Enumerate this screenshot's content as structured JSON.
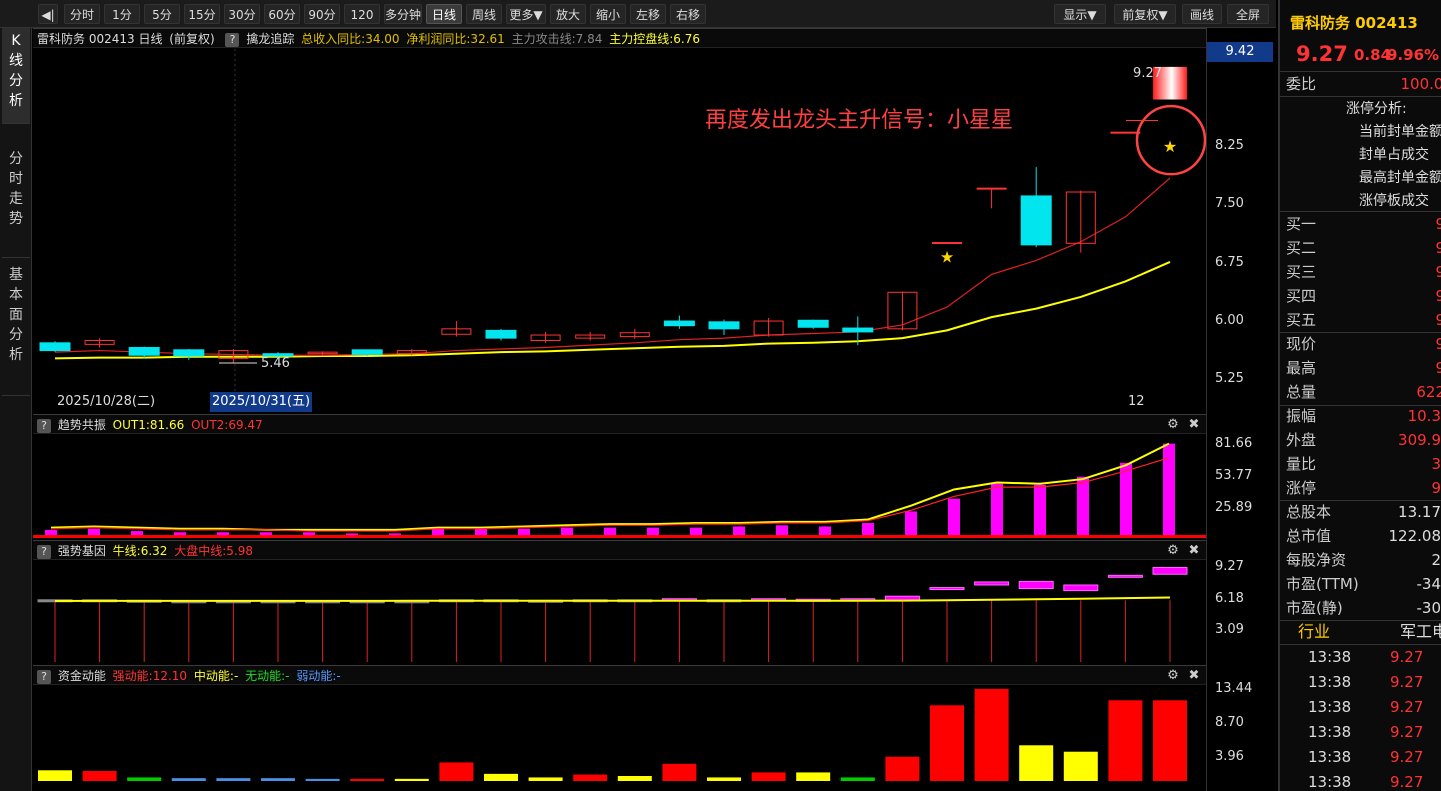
{
  "toolbar": {
    "back_icon": "back-arrow-icon",
    "buttons": [
      "分时",
      "1分",
      "5分",
      "15分",
      "30分",
      "60分",
      "90分",
      "120分",
      "多分钟",
      "日线",
      "周线",
      "更多▼",
      "放大",
      "缩小",
      "左移",
      "右移"
    ],
    "active": "日线",
    "right_buttons": [
      "显示▼",
      "前复权▼",
      "画线",
      "全屏"
    ]
  },
  "sidebar": {
    "tabs": [
      "K线分析",
      "分时走势",
      "基本面分析"
    ]
  },
  "main_header": {
    "stock": "雷科防务 002413 日线",
    "adjust": "(前复权)",
    "indicator": "擒龙追踪",
    "revenue": "总收入同比:34.00",
    "profit": "净利润同比:32.61",
    "attack": "主力攻击线:7.84",
    "control": "主力控盘线:6.76"
  },
  "price_axis": {
    "current": "9.42",
    "ticks": [
      "8.25",
      "7.50",
      "6.75",
      "6.00",
      "5.25"
    ]
  },
  "annotation": {
    "text": "再度发出龙头主升信号：小星星",
    "high_label": "9.27",
    "low_label": "5.46"
  },
  "dates": {
    "d1": "2025/10/28(二)",
    "d2": "2025/10/31(五)",
    "d3": "12"
  },
  "ind1": {
    "name": "趋势共振",
    "out1": "OUT1:81.66",
    "out2": "OUT2:69.47",
    "ticks": [
      "81.66",
      "53.77",
      "25.89"
    ]
  },
  "ind2": {
    "name": "强势基因",
    "bull": "牛线:6.32",
    "market": "大盘中线:5.98",
    "ticks": [
      "9.27",
      "6.18",
      "3.09"
    ]
  },
  "ind3": {
    "name": "资金动能",
    "strong": "强动能:12.10",
    "mid": "中动能:-",
    "none": "无动能:-",
    "weak": "弱动能:-",
    "ticks": [
      "13.44",
      "8.70",
      "3.96"
    ]
  },
  "quote": {
    "name_code": "雷科防务 002413",
    "price": "9.27",
    "change": "0.84",
    "pct": "9.96%",
    "weibi_label": "委比",
    "weibi_value": "100.00",
    "limit_lines": [
      "涨停分析:",
      "当前封单金额",
      "封单占成交",
      "最高封单金额",
      "涨停板成交"
    ],
    "bids": [
      {
        "l": "买一",
        "v": "9"
      },
      {
        "l": "买二",
        "v": "9"
      },
      {
        "l": "买三",
        "v": "9"
      },
      {
        "l": "买四",
        "v": "9"
      },
      {
        "l": "买五",
        "v": "9"
      }
    ],
    "stats1": [
      {
        "l": "现价",
        "v": "9"
      },
      {
        "l": "最高",
        "v": "9"
      },
      {
        "l": "总量",
        "v": "622"
      }
    ],
    "stats2": [
      {
        "l": "振幅",
        "v": "10.3"
      },
      {
        "l": "外盘",
        "v": "309.9"
      },
      {
        "l": "量比",
        "v": "3"
      },
      {
        "l": "涨停",
        "v": "9"
      }
    ],
    "stats3": [
      {
        "l": "总股本",
        "v": "13.17"
      },
      {
        "l": "总市值",
        "v": "122.08"
      },
      {
        "l": "每股净资",
        "v": "2"
      },
      {
        "l": "市盈(TTM)",
        "v": "-34"
      },
      {
        "l": "市盈(静)",
        "v": "-30"
      }
    ],
    "industry_label": "行业",
    "industry_value": "军工电",
    "ticks": [
      {
        "t": "13:38",
        "p": "9.27"
      },
      {
        "t": "13:38",
        "p": "9.27"
      },
      {
        "t": "13:38",
        "p": "9.27"
      },
      {
        "t": "13:38",
        "p": "9.27"
      },
      {
        "t": "13:38",
        "p": "9.27"
      },
      {
        "t": "13:38",
        "p": "9.27"
      }
    ]
  },
  "chart_data": [
    {
      "type": "candlestick",
      "ylim": [
        5.1,
        9.5
      ],
      "ticks": [
        8.25,
        7.5,
        6.75,
        6.0,
        5.25
      ],
      "candles": [
        {
          "o": 5.72,
          "c": 5.62,
          "h": 5.74,
          "l": 5.6
        },
        {
          "o": 5.7,
          "c": 5.75,
          "h": 5.78,
          "l": 5.66
        },
        {
          "o": 5.66,
          "c": 5.56,
          "h": 5.67,
          "l": 5.52
        },
        {
          "o": 5.63,
          "c": 5.55,
          "h": 5.64,
          "l": 5.5
        },
        {
          "o": 5.52,
          "c": 5.62,
          "h": 5.64,
          "l": 5.46
        },
        {
          "o": 5.58,
          "c": 5.55,
          "h": 5.6,
          "l": 5.52
        },
        {
          "o": 5.58,
          "c": 5.6,
          "h": 5.61,
          "l": 5.55
        },
        {
          "o": 5.63,
          "c": 5.57,
          "h": 5.63,
          "l": 5.55
        },
        {
          "o": 5.58,
          "c": 5.62,
          "h": 5.64,
          "l": 5.56
        },
        {
          "o": 5.83,
          "c": 5.9,
          "h": 6.0,
          "l": 5.8
        },
        {
          "o": 5.88,
          "c": 5.78,
          "h": 5.9,
          "l": 5.75
        },
        {
          "o": 5.75,
          "c": 5.82,
          "h": 5.86,
          "l": 5.72
        },
        {
          "o": 5.78,
          "c": 5.82,
          "h": 5.86,
          "l": 5.75
        },
        {
          "o": 5.8,
          "c": 5.85,
          "h": 5.9,
          "l": 5.77
        },
        {
          "o": 6.0,
          "c": 5.94,
          "h": 6.07,
          "l": 5.9
        },
        {
          "o": 5.99,
          "c": 5.9,
          "h": 6.02,
          "l": 5.82
        },
        {
          "o": 5.82,
          "c": 6.0,
          "h": 6.04,
          "l": 5.8
        },
        {
          "o": 6.01,
          "c": 5.92,
          "h": 6.02,
          "l": 5.9
        },
        {
          "o": 5.91,
          "c": 5.86,
          "h": 6.06,
          "l": 5.69
        },
        {
          "o": 5.9,
          "c": 6.37,
          "h": 6.38,
          "l": 5.88
        },
        {
          "o": 7.01,
          "c": 7.01,
          "h": 7.01,
          "l": 7.01
        },
        {
          "o": 7.71,
          "c": 7.71,
          "h": 7.71,
          "l": 7.45
        },
        {
          "o": 7.61,
          "c": 6.98,
          "h": 7.98,
          "l": 6.95
        },
        {
          "o": 7.0,
          "c": 7.66,
          "h": 7.68,
          "l": 6.88
        },
        {
          "o": 8.43,
          "c": 8.43,
          "h": 8.43,
          "l": 8.43
        },
        {
          "o": 8.85,
          "c": 9.27,
          "h": 9.27,
          "l": 8.85
        }
      ],
      "ma_red": [
        5.6,
        5.62,
        5.6,
        5.58,
        5.57,
        5.56,
        5.56,
        5.57,
        5.58,
        5.62,
        5.64,
        5.66,
        5.69,
        5.72,
        5.76,
        5.78,
        5.82,
        5.84,
        5.86,
        5.95,
        6.18,
        6.6,
        6.78,
        7.02,
        7.34,
        7.84
      ],
      "ma_yellow": [
        5.52,
        5.53,
        5.53,
        5.54,
        5.54,
        5.54,
        5.55,
        5.55,
        5.56,
        5.58,
        5.6,
        5.61,
        5.63,
        5.65,
        5.67,
        5.68,
        5.71,
        5.72,
        5.74,
        5.78,
        5.88,
        6.05,
        6.16,
        6.31,
        6.51,
        6.76
      ],
      "stars": [
        {
          "index": 20,
          "value": 6.83
        },
        {
          "index": 25,
          "value": 8.25
        }
      ]
    },
    {
      "type": "bar",
      "name": "趋势共振",
      "ylim": [
        0,
        90
      ],
      "bars": [
        7,
        8,
        6,
        5,
        5,
        5,
        5,
        4,
        4,
        8,
        8,
        8,
        9,
        9,
        9,
        9,
        10,
        11,
        10,
        13,
        23,
        34,
        47,
        46,
        53,
        65,
        81.66
      ],
      "out1": [
        9,
        10,
        9,
        8,
        8,
        7,
        7,
        7,
        7,
        9,
        9,
        10,
        11,
        12,
        12,
        13,
        13,
        14,
        14,
        16,
        28,
        42,
        48,
        47,
        51,
        63,
        81.66
      ],
      "out2": [
        8,
        9,
        8,
        7,
        7,
        7,
        6,
        6,
        6,
        8,
        8,
        9,
        10,
        11,
        11,
        12,
        12,
        13,
        13,
        15,
        24,
        36,
        44,
        44,
        48,
        58,
        69.47
      ]
    },
    {
      "type": "bar",
      "name": "强势基因",
      "ylim": [
        0,
        10
      ],
      "bull": 6.32,
      "market": 5.98
    },
    {
      "type": "bar",
      "name": "资金动能",
      "ylim": [
        0,
        14
      ],
      "bars": [
        {
          "v": 1.5,
          "c": "yellow"
        },
        {
          "v": 1.4,
          "c": "red"
        },
        {
          "v": 0.5,
          "c": "green"
        },
        {
          "v": 0.4,
          "c": "blue"
        },
        {
          "v": 0.4,
          "c": "blue"
        },
        {
          "v": 0.4,
          "c": "blue"
        },
        {
          "v": 0.3,
          "c": "blue"
        },
        {
          "v": 0.3,
          "c": "red"
        },
        {
          "v": 0.3,
          "c": "yellow"
        },
        {
          "v": 2.6,
          "c": "red"
        },
        {
          "v": 1.0,
          "c": "yellow"
        },
        {
          "v": 0.5,
          "c": "yellow"
        },
        {
          "v": 0.9,
          "c": "red"
        },
        {
          "v": 0.7,
          "c": "yellow"
        },
        {
          "v": 2.4,
          "c": "red"
        },
        {
          "v": 0.5,
          "c": "yellow"
        },
        {
          "v": 1.2,
          "c": "red"
        },
        {
          "v": 1.2,
          "c": "yellow"
        },
        {
          "v": 0.5,
          "c": "green"
        },
        {
          "v": 3.4,
          "c": "red"
        },
        {
          "v": 10.6,
          "c": "red"
        },
        {
          "v": 12.9,
          "c": "red"
        },
        {
          "v": 5.0,
          "c": "yellow"
        },
        {
          "v": 4.1,
          "c": "yellow"
        },
        {
          "v": 11.3,
          "c": "red"
        },
        {
          "v": 11.3,
          "c": "red"
        }
      ]
    }
  ]
}
